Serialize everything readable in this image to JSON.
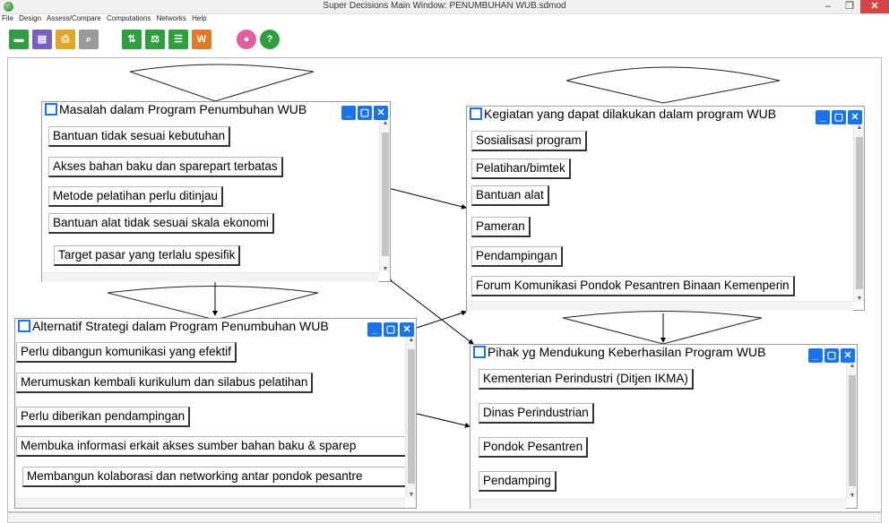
{
  "window": {
    "title": "Super Decisions Main Window: PENUMBUHAN WUB.sdmod",
    "minimize": "–",
    "maximize": "❐",
    "close": "✕"
  },
  "menu": [
    "File",
    "Design",
    "Assess/Compare",
    "Computations",
    "Networks",
    "Help"
  ],
  "toolbar": {
    "buttons": [
      {
        "name": "open-file-icon",
        "glyph": "▬",
        "color": "#2e9e3e"
      },
      {
        "name": "save-icon",
        "glyph": "▤",
        "color": "#7a5fc0"
      },
      {
        "name": "print-icon",
        "glyph": "⎙",
        "color": "#e0a72a"
      },
      {
        "name": "attach-icon",
        "glyph": "⌕",
        "color": "#9a9a9a"
      },
      {
        "name": "sort-icon",
        "glyph": "⇅",
        "color": "#2e9e3e"
      },
      {
        "name": "balance-icon",
        "glyph": "⚖",
        "color": "#2e9e3e"
      },
      {
        "name": "sliders-icon",
        "glyph": "☰",
        "color": "#2e9e3e"
      },
      {
        "name": "swot-icon",
        "glyph": "W",
        "color": "#e07a2a"
      },
      {
        "name": "pin-icon",
        "glyph": "●",
        "color": "#e0609e"
      },
      {
        "name": "help-icon",
        "glyph": "?",
        "color": "#2e9e3e"
      }
    ]
  },
  "clusters": {
    "masalah": {
      "title": "Masalah dalam Program Penumbuhan WUB",
      "nodes": [
        "Bantuan tidak sesuai kebutuhan",
        "Akses bahan baku dan sparepart terbatas",
        "Metode pelatihan perlu ditinjau",
        "Bantuan alat tidak  sesuai skala ekonomi",
        "Target pasar yang terlalu spesifik"
      ]
    },
    "kegiatan": {
      "title": "Kegiatan yang dapat dilakukan dalam program WUB",
      "nodes": [
        "Sosialisasi program",
        "Pelatihan/bimtek",
        "Bantuan alat",
        "Pameran",
        "Pendampingan",
        "Forum Komunikasi Pondok Pesantren Binaan Kemenperin"
      ]
    },
    "alternatif": {
      "title": "Alternatif Strategi dalam Program Penumbuhan WUB",
      "nodes": [
        "Perlu dibangun komunikasi yang efektif",
        "Merumuskan kembali kurikulum dan silabus pelatihan",
        "Perlu diberikan pendampingan",
        "Membuka informasi erkait akses sumber bahan baku & sparep",
        "Membangun kolaborasi dan networking antar pondok pesantre"
      ]
    },
    "pihak": {
      "title": "Pihak yg Mendukung Keberhasilan Program WUB",
      "nodes": [
        "Kementerian Perindustri (Ditjen IKMA)",
        "Dinas Perindustrian",
        "Pondok Pesantren",
        "Pendamping"
      ]
    }
  },
  "cluster_buttons": {
    "minimize": "_",
    "restore": "▢",
    "close": "✕"
  }
}
